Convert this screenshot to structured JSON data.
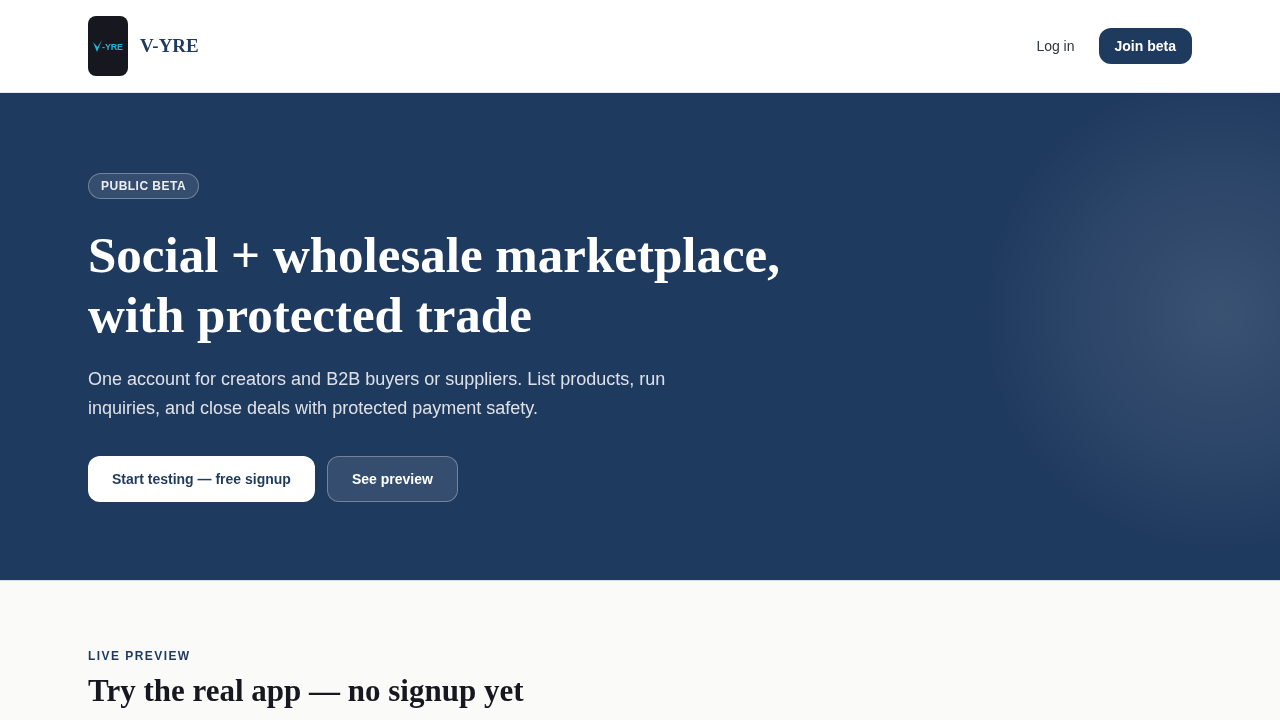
{
  "header": {
    "logo": {
      "mark_text": "-YRE"
    },
    "brand": "V-YRE",
    "nav": [
      {
        "kind": "link",
        "label": "Log in"
      },
      {
        "kind": "primary",
        "label": "Join beta"
      }
    ]
  },
  "hero": {
    "badge": "PUBLIC BETA",
    "title": "Social + wholesale marketplace, with protected trade",
    "subtitle": "One account for creators and B2B buyers or suppliers. List products, run inquiries, and close deals with protected payment safety.",
    "buttons": [
      {
        "kind": "solid",
        "label": "Start testing — free signup"
      },
      {
        "kind": "outline",
        "label": "See preview"
      }
    ]
  },
  "preview_section": {
    "eyebrow": "LIVE PREVIEW",
    "title": "Try the real app — no signup yet"
  }
}
